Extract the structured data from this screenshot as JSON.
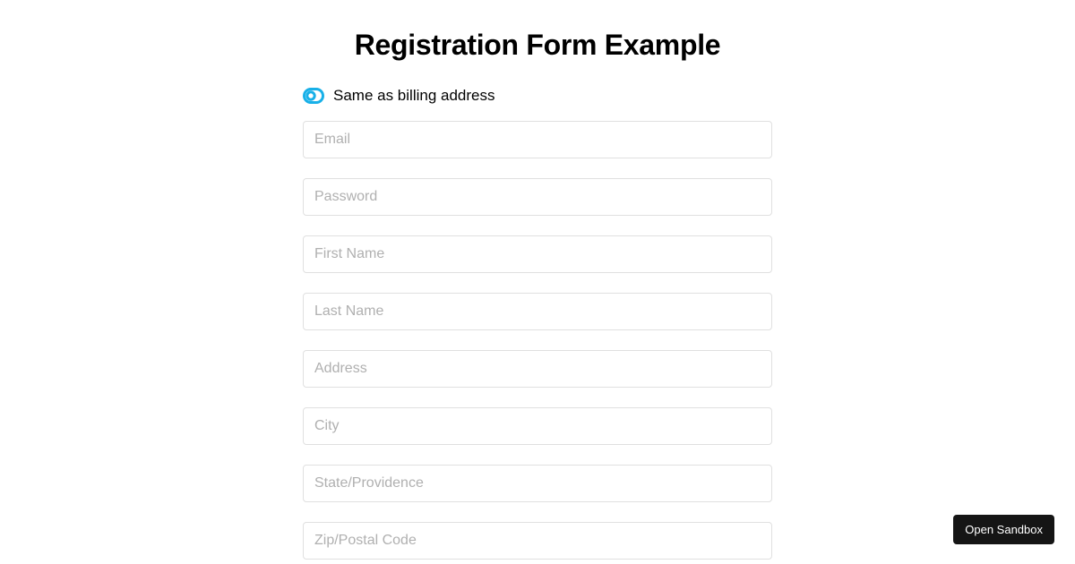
{
  "title": "Registration Form Example",
  "toggle": {
    "label": "Same as billing address",
    "color": "#18b0e8"
  },
  "fields": {
    "email": {
      "placeholder": "Email"
    },
    "password": {
      "placeholder": "Password"
    },
    "firstName": {
      "placeholder": "First Name"
    },
    "lastName": {
      "placeholder": "Last Name"
    },
    "address": {
      "placeholder": "Address"
    },
    "city": {
      "placeholder": "City"
    },
    "state": {
      "placeholder": "State/Providence"
    },
    "zip": {
      "placeholder": "Zip/Postal Code"
    }
  },
  "sandboxButton": "Open Sandbox"
}
